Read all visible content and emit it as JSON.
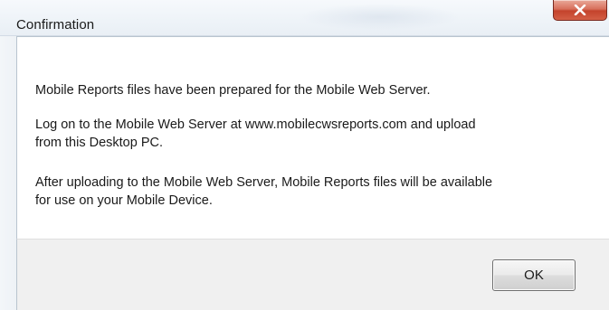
{
  "window": {
    "title": "Confirmation",
    "close_icon": "close-x-icon"
  },
  "message": {
    "paragraph_1": "Mobile Reports files have been prepared for the Mobile Web Server.",
    "paragraph_2_line_1": "Log on to the Mobile Web Server at www.mobilecwsreports.com and upload",
    "paragraph_2_line_2": "from this Desktop PC.",
    "paragraph_3_line_1": "After uploading to the Mobile Web Server, Mobile Reports files will be available",
    "paragraph_3_line_2": "for use on your Mobile Device."
  },
  "buttons": {
    "ok_label": "OK"
  },
  "colors": {
    "close_button": "#c4432c",
    "footer_background": "#f0f0f0",
    "content_background": "#ffffff"
  }
}
